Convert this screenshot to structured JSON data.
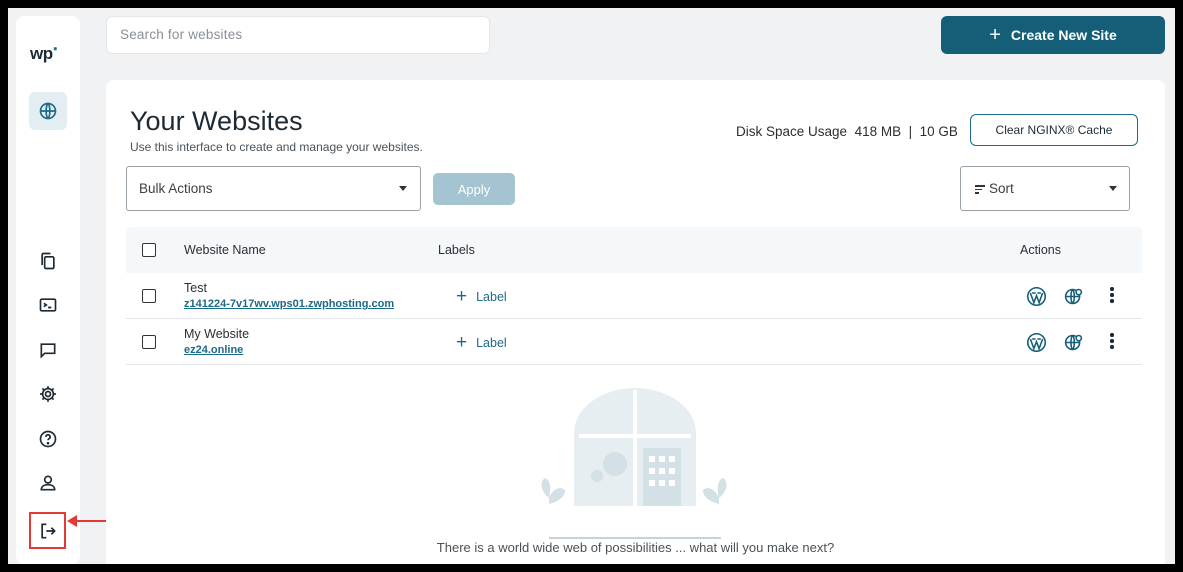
{
  "sidebar": {
    "logo": "wp",
    "items": [
      {
        "name": "sites",
        "icon": "globe-icon"
      },
      {
        "name": "files",
        "icon": "copy-icon"
      },
      {
        "name": "terminal",
        "icon": "terminal-icon"
      },
      {
        "name": "chat",
        "icon": "chat-icon"
      },
      {
        "name": "settings",
        "icon": "gear-icon"
      },
      {
        "name": "help",
        "icon": "help-icon"
      },
      {
        "name": "account",
        "icon": "user-icon"
      },
      {
        "name": "logout",
        "icon": "logout-icon"
      }
    ]
  },
  "header": {
    "search_placeholder": "Search for websites",
    "create_button": "Create New Site"
  },
  "main": {
    "title": "Your Websites",
    "subtitle": "Use this interface to create and manage your websites.",
    "disk_label": "Disk Space Usage",
    "disk_used": "418 MB",
    "disk_separator": "|",
    "disk_total": "10 GB",
    "clear_cache_button": "Clear NGINX® Cache",
    "bulk_actions": "Bulk Actions",
    "apply_button": "Apply",
    "sort": "Sort",
    "columns": {
      "name": "Website Name",
      "labels": "Labels",
      "actions": "Actions"
    },
    "rows": [
      {
        "name": "Test",
        "url": "z141224-7v17wv.wps01.zwphosting.com",
        "label": "Label"
      },
      {
        "name": "My Website",
        "url": "ez24.online",
        "label": "Label"
      }
    ],
    "empty_text": "There is a world wide web of possibilities ... what will you make next?"
  },
  "colors": {
    "primary": "#155e78",
    "accent": "#1d6a86",
    "highlight": "#e53935"
  }
}
